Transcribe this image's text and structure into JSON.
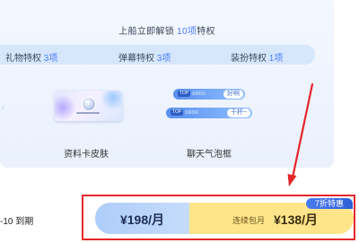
{
  "header": {
    "title_prefix": "上船立即解锁 ",
    "title_count": "10项",
    "title_suffix": "特权"
  },
  "privileges": [
    {
      "label": "礼物特权 ",
      "count": "3项"
    },
    {
      "label": "弹幕特权 ",
      "count": "3项"
    },
    {
      "label": "装扮特权 ",
      "count": "1项"
    }
  ],
  "features": [
    {
      "label": "资料卡皮肤",
      "icon": "profile-card-skin-preview"
    },
    {
      "label": "聊天气泡框",
      "icon": "chat-bubble-preview"
    }
  ],
  "bubbles": [
    {
      "tag": "TOP",
      "blur": "bilibili",
      "tail": "好啊"
    },
    {
      "tag": "TOP",
      "blur": "bilibili",
      "tail": "干杯~"
    }
  ],
  "expiry_text": "-10 到期",
  "plans": {
    "monthly_price": "¥198/月",
    "subscription_label": "连续包月",
    "subscription_price": "¥138/月",
    "discount_badge": "7折特惠"
  },
  "colors": {
    "accent_blue": "#4b7bff",
    "highlight_red": "#e6262b",
    "plan_left": "#aecdfa",
    "plan_right": "#fee58a"
  }
}
